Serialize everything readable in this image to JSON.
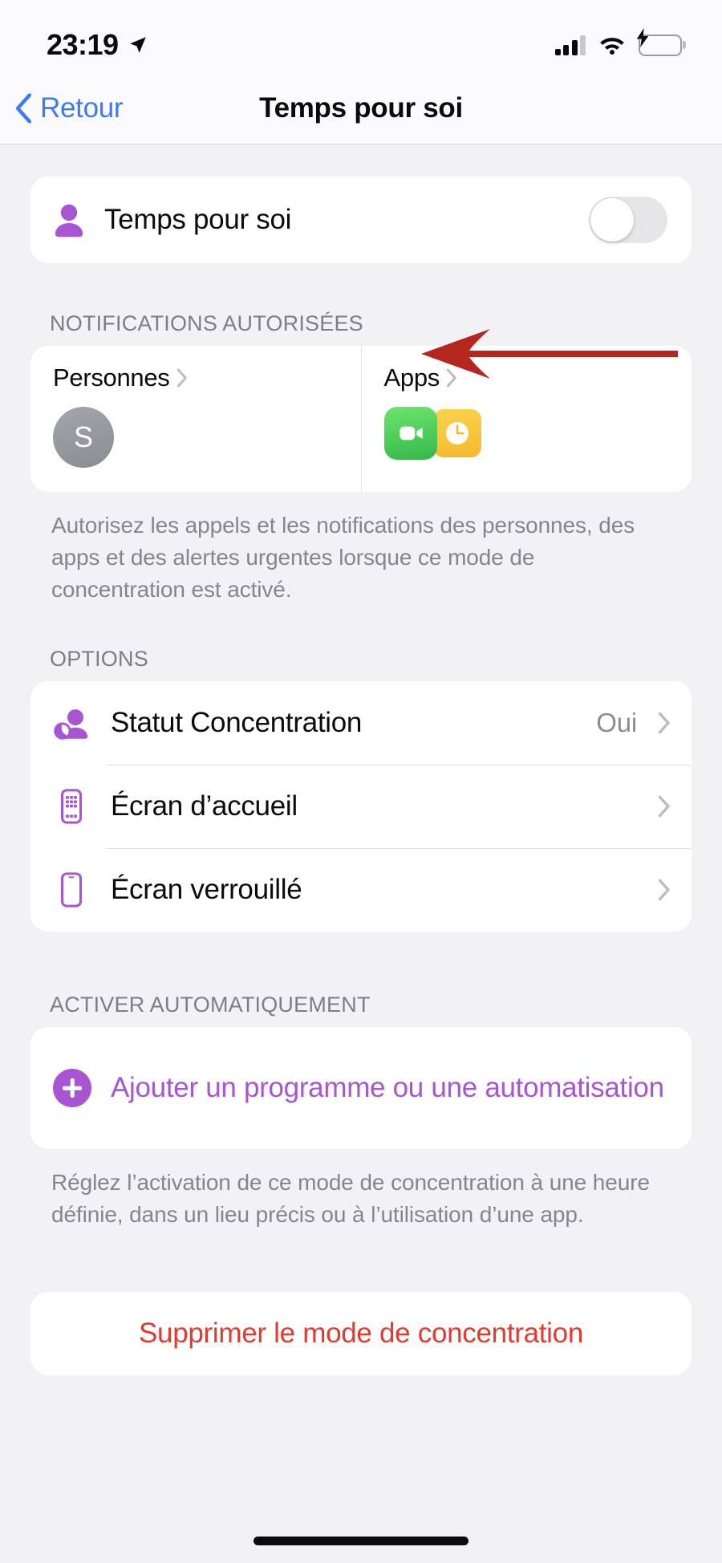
{
  "status_bar": {
    "time": "23:19",
    "location_icon": "location-arrow-icon",
    "signal_icon": "cellular-signal-icon",
    "wifi_icon": "wifi-icon",
    "battery_icon": "battery-charging-icon"
  },
  "nav": {
    "back_label": "Retour",
    "title": "Temps pour soi",
    "back_icon": "chevron-left-icon"
  },
  "focus_toggle": {
    "icon": "person-icon",
    "label": "Temps pour soi",
    "state": "off"
  },
  "notifications": {
    "header": "NOTIFICATIONS AUTORISÉES",
    "people": {
      "title": "Personnes",
      "chevron": "chevron-right-icon",
      "avatar_initial": "S"
    },
    "apps": {
      "title": "Apps",
      "chevron": "chevron-right-icon",
      "app_icons": [
        "facetime-icon",
        "clock-icon"
      ]
    },
    "footer": "Autorisez les appels et les notifications des personnes, des apps et des alertes urgentes lorsque ce mode de concentration est activé."
  },
  "options": {
    "header": "OPTIONS",
    "rows": [
      {
        "icon": "focus-status-icon",
        "label": "Statut Concentration",
        "value": "Oui",
        "chevron": "chevron-right-icon"
      },
      {
        "icon": "home-screen-icon",
        "label": "Écran d’accueil",
        "value": "",
        "chevron": "chevron-right-icon"
      },
      {
        "icon": "lock-screen-icon",
        "label": "Écran verrouillé",
        "value": "",
        "chevron": "chevron-right-icon"
      }
    ]
  },
  "automation": {
    "header": "ACTIVER AUTOMATIQUEMENT",
    "add_icon": "plus-circle-icon",
    "add_label": "Ajouter un programme ou une automatisation",
    "footer": "Réglez l’activation de ce mode de concentration à une heure définie, dans un lieu précis ou à l’utilisation d’une app."
  },
  "delete": {
    "label": "Supprimer le mode de concentration"
  },
  "annotation": {
    "arrow_icon": "red-arrow-left-icon",
    "color": "#b5261e"
  },
  "colors": {
    "accent_purple": "#a855d4",
    "link_blue": "#3c7bf6",
    "destructive_red": "#e03b2f",
    "page_background": "#f2f1f6",
    "card_background": "#ffffff"
  }
}
